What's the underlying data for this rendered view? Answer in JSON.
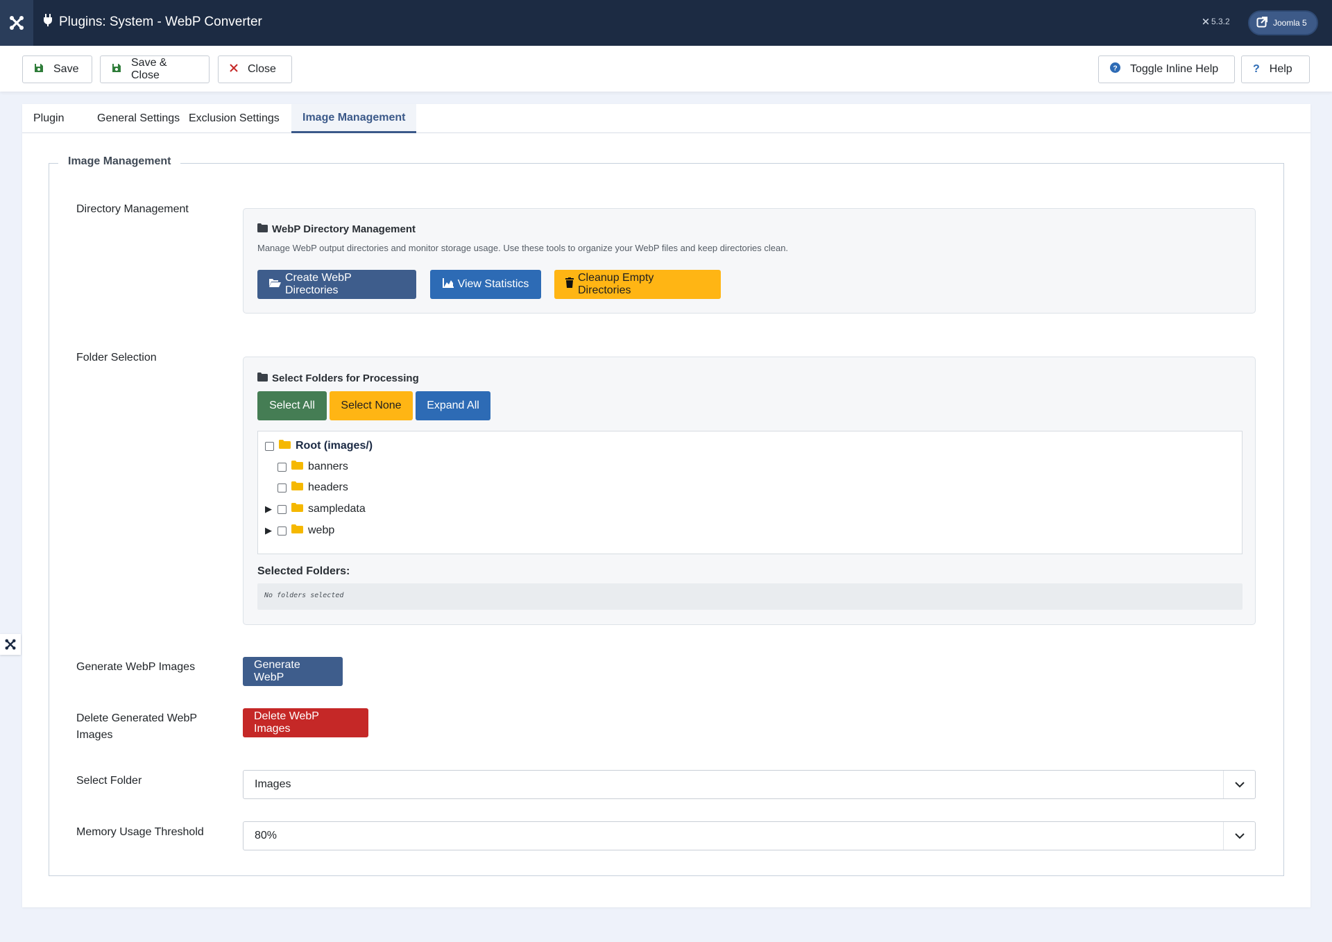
{
  "header": {
    "title": "Plugins: System - WebP Converter",
    "version": "5.3.2",
    "joomla_label": "Joomla 5"
  },
  "toolbar": {
    "save": "Save",
    "save_close": "Save & Close",
    "close": "Close",
    "toggle_help": "Toggle Inline Help",
    "help": "Help"
  },
  "tabs": [
    "Plugin",
    "General Settings",
    "Exclusion Settings",
    "Image Management"
  ],
  "active_tab": "Image Management",
  "fieldset": {
    "legend": "Image Management"
  },
  "directory": {
    "label": "Directory Management",
    "title": "WebP Directory Management",
    "description": "Manage WebP output directories and monitor storage usage. Use these tools to organize your WebP files and keep directories clean.",
    "btn_create": "Create WebP Directories",
    "btn_stats": "View Statistics",
    "btn_cleanup": "Cleanup Empty Directories"
  },
  "folders": {
    "label": "Folder Selection",
    "title": "Select Folders for Processing",
    "btn_select_all": "Select All",
    "btn_select_none": "Select None",
    "btn_expand_all": "Expand All",
    "tree": {
      "root": "Root (images/)",
      "children": [
        "banners",
        "headers",
        "sampledata",
        "webp"
      ]
    },
    "selected_label": "Selected Folders:",
    "selected_value": "No folders selected"
  },
  "generate": {
    "label": "Generate WebP Images",
    "button": "Generate WebP"
  },
  "delete": {
    "label_line1": "Delete Generated WebP",
    "label_line2": "Images",
    "button": "Delete WebP Images"
  },
  "select_folder": {
    "label": "Select Folder",
    "value": "Images"
  },
  "memory": {
    "label": "Memory Usage Threshold",
    "value": "80%"
  },
  "colors": {
    "header_bg": "#1c2b43",
    "accent": "#3b5989",
    "blue": "#2d6bb5",
    "yellow": "#ffb514",
    "green": "#457d54",
    "red": "#c52827",
    "folder": "#f5b800"
  },
  "icons": [
    "joomla-logo-icon",
    "plug-icon",
    "save-icon",
    "close-icon",
    "help-circle-icon",
    "question-icon",
    "external-link-icon",
    "folder-icon",
    "folder-open-icon",
    "chart-icon",
    "trash-icon",
    "expand-arrow-icon",
    "chevron-down-icon"
  ]
}
